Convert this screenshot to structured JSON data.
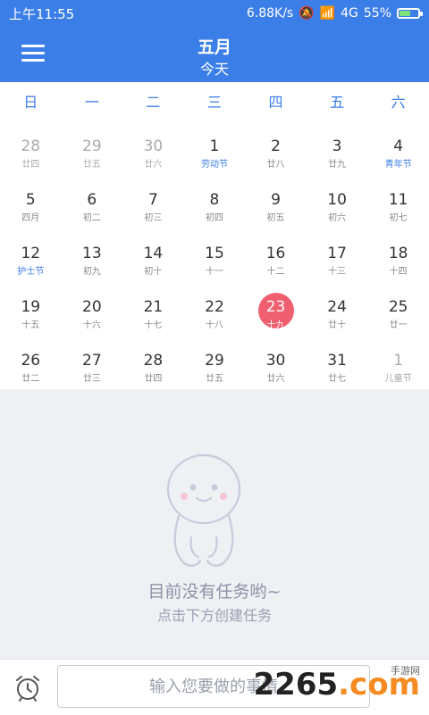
{
  "status_bar": {
    "time": "上午11:55",
    "network_speed": "6.88K/s",
    "signal": "4G",
    "battery": "55%",
    "battery_level": 0.55
  },
  "header": {
    "title": "五月",
    "subtitle": "今天"
  },
  "calendar": {
    "weekdays": [
      "日",
      "一",
      "二",
      "三",
      "四",
      "五",
      "六"
    ],
    "days": [
      {
        "num": "28",
        "lunar": "廿四",
        "other": true
      },
      {
        "num": "29",
        "lunar": "廿五",
        "other": true
      },
      {
        "num": "30",
        "lunar": "廿六",
        "other": true
      },
      {
        "num": "1",
        "lunar": "劳动节",
        "festival": true
      },
      {
        "num": "2",
        "lunar": "廿八"
      },
      {
        "num": "3",
        "lunar": "廿九"
      },
      {
        "num": "4",
        "lunar": "青年节",
        "festival": true
      },
      {
        "num": "5",
        "lunar": "四月"
      },
      {
        "num": "6",
        "lunar": "初二"
      },
      {
        "num": "7",
        "lunar": "初三"
      },
      {
        "num": "8",
        "lunar": "初四"
      },
      {
        "num": "9",
        "lunar": "初五"
      },
      {
        "num": "10",
        "lunar": "初六"
      },
      {
        "num": "11",
        "lunar": "初七"
      },
      {
        "num": "12",
        "lunar": "护士节",
        "festival": true
      },
      {
        "num": "13",
        "lunar": "初九"
      },
      {
        "num": "14",
        "lunar": "初十"
      },
      {
        "num": "15",
        "lunar": "十一"
      },
      {
        "num": "16",
        "lunar": "十二"
      },
      {
        "num": "17",
        "lunar": "十三"
      },
      {
        "num": "18",
        "lunar": "十四"
      },
      {
        "num": "19",
        "lunar": "十五"
      },
      {
        "num": "20",
        "lunar": "十六"
      },
      {
        "num": "21",
        "lunar": "十七"
      },
      {
        "num": "22",
        "lunar": "十八"
      },
      {
        "num": "23",
        "lunar": "十九",
        "today": true
      },
      {
        "num": "24",
        "lunar": "廿十"
      },
      {
        "num": "25",
        "lunar": "廿一"
      },
      {
        "num": "26",
        "lunar": "廿二"
      },
      {
        "num": "27",
        "lunar": "廿三"
      },
      {
        "num": "28",
        "lunar": "廿四"
      },
      {
        "num": "29",
        "lunar": "廿五"
      },
      {
        "num": "30",
        "lunar": "廿六"
      },
      {
        "num": "31",
        "lunar": "廿七"
      },
      {
        "num": "1",
        "lunar": "儿童节",
        "other": true
      }
    ]
  },
  "empty_state": {
    "title": "目前没有任务哟~",
    "subtitle": "点击下方创建任务"
  },
  "bottom_bar": {
    "input_placeholder": "输入您要做的事情",
    "watermark_text": "2265",
    "watermark_suffix": ".com",
    "watermark_small": "手游网"
  },
  "colors": {
    "primary": "#3b7ee8",
    "today": "#ef5f6f",
    "festival": "#3b7ee8"
  }
}
